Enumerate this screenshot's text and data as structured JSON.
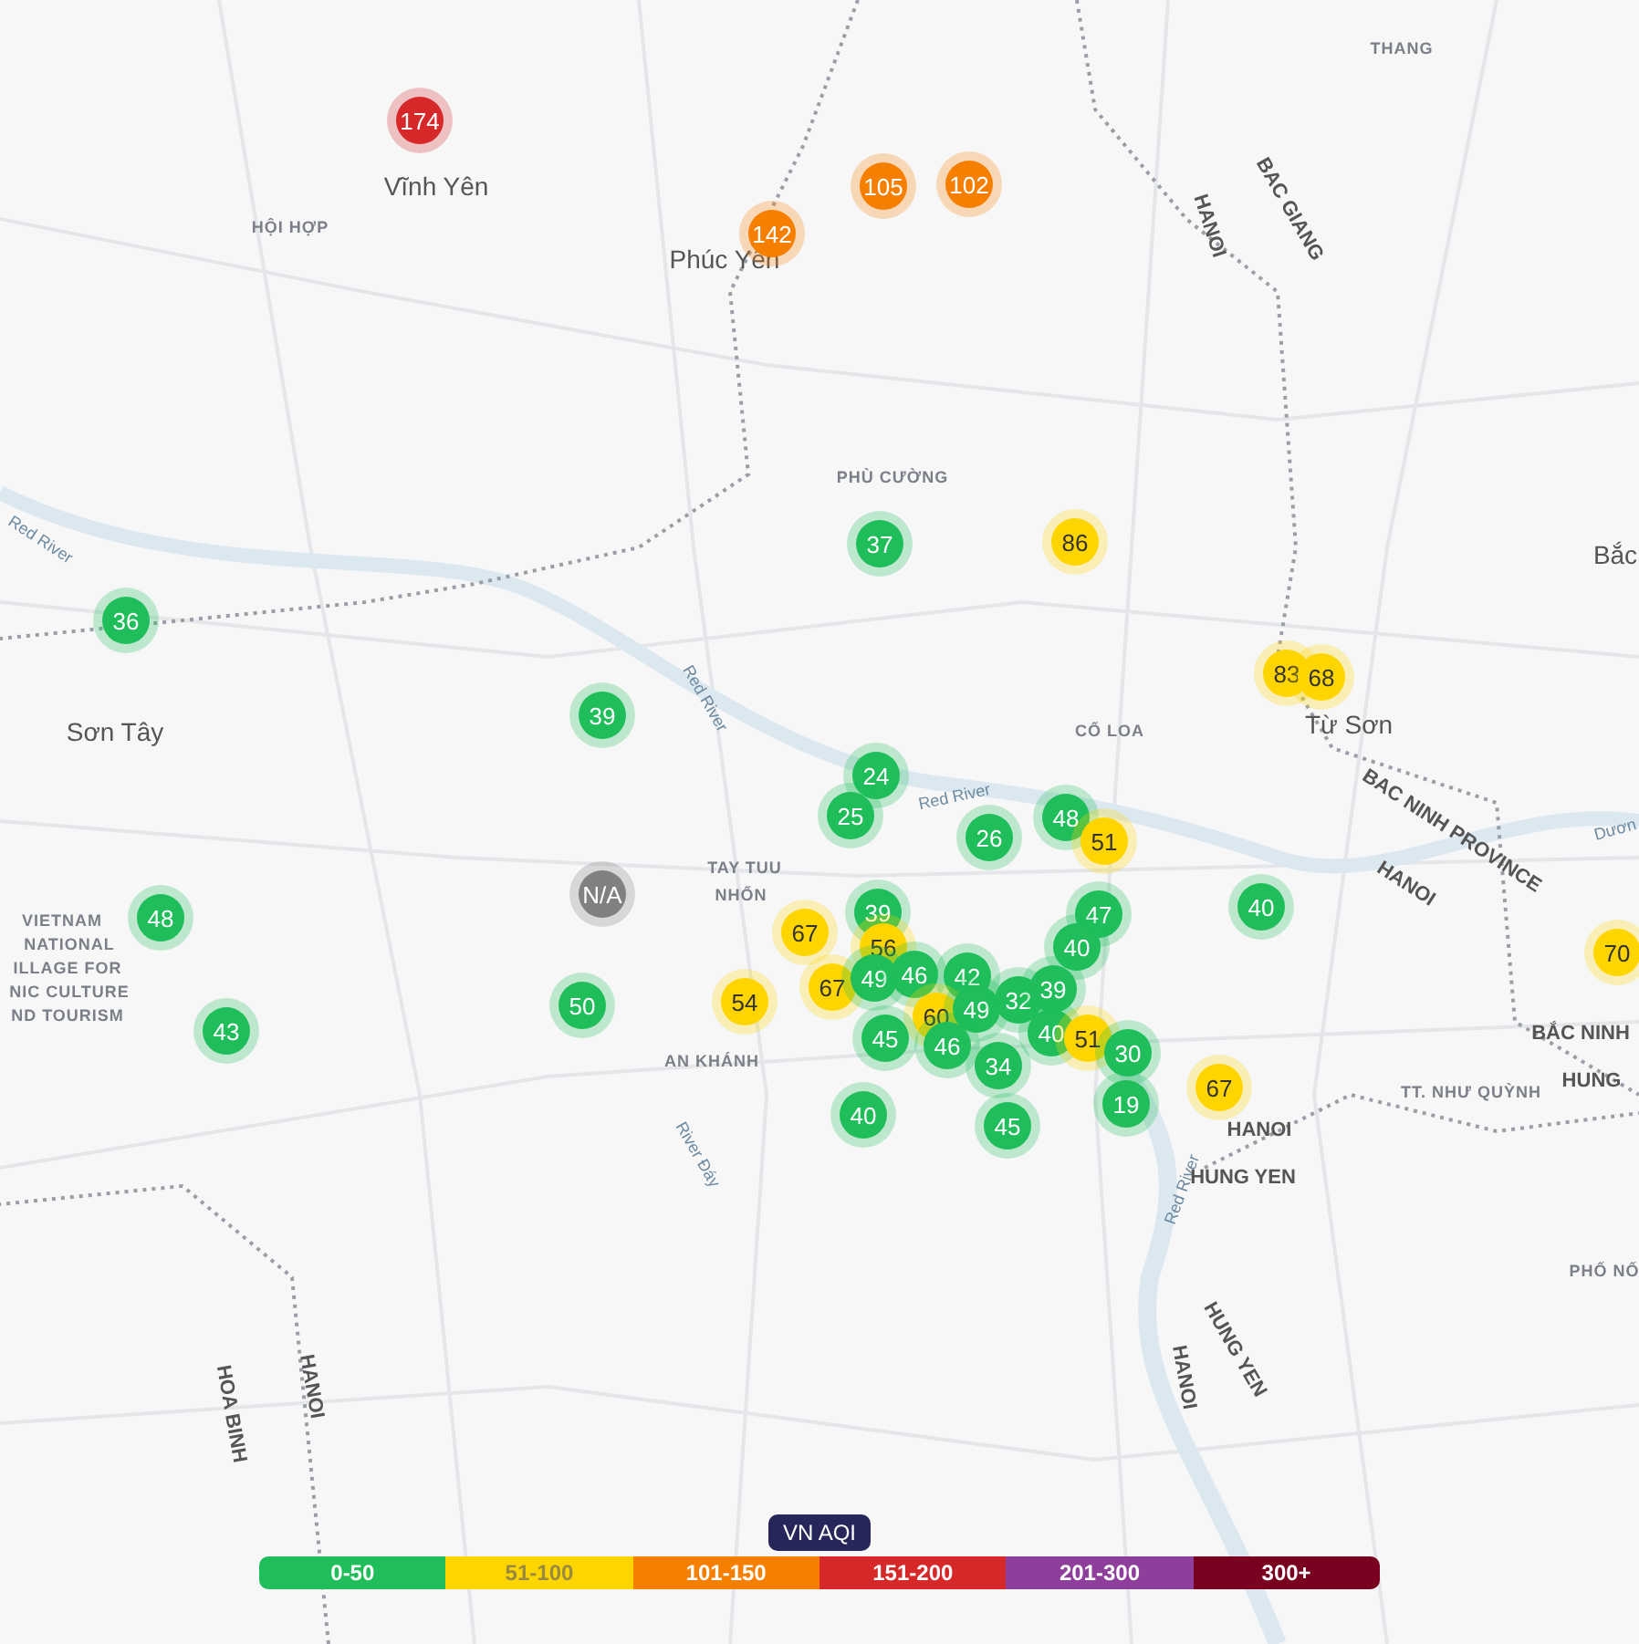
{
  "map": {
    "labels": [
      {
        "text": "Vĩnh Yên",
        "kind": "city"
      },
      {
        "text": "HỘI HỢP",
        "kind": "district"
      },
      {
        "text": "Phúc Yên",
        "kind": "city"
      },
      {
        "text": "THANG",
        "kind": "district"
      },
      {
        "text": "BAC GIANG",
        "kind": "region"
      },
      {
        "text": "HANOI",
        "kind": "region"
      },
      {
        "text": "PHÙ CƯỜNG",
        "kind": "district"
      },
      {
        "text": "Bắc",
        "kind": "city"
      },
      {
        "text": "Red River",
        "kind": "water"
      },
      {
        "text": "Sơn Tây",
        "kind": "city"
      },
      {
        "text": "Red River",
        "kind": "water"
      },
      {
        "text": "CỔ LOA",
        "kind": "district"
      },
      {
        "text": "Từ Sơn",
        "kind": "city"
      },
      {
        "text": "Red River",
        "kind": "water"
      },
      {
        "text": "BAC NINH PROVINCE",
        "kind": "region"
      },
      {
        "text": "HANOI",
        "kind": "region"
      },
      {
        "text": "Dươn",
        "kind": "water"
      },
      {
        "text": "TAY TUU",
        "kind": "district"
      },
      {
        "text": "NHỔN",
        "kind": "district"
      },
      {
        "text": "VIETNAM",
        "kind": "district"
      },
      {
        "text": "NATIONAL",
        "kind": "district"
      },
      {
        "text": "ILLAGE FOR",
        "kind": "district"
      },
      {
        "text": "NIC CULTURE",
        "kind": "district"
      },
      {
        "text": "ND TOURISM",
        "kind": "district"
      },
      {
        "text": "AN KHÁNH",
        "kind": "district"
      },
      {
        "text": "River Đáy",
        "kind": "water"
      },
      {
        "text": "BẮC NINH",
        "kind": "region"
      },
      {
        "text": "HUNG",
        "kind": "region"
      },
      {
        "text": "TT. NHƯ QUỲNH",
        "kind": "district"
      },
      {
        "text": "HANOI",
        "kind": "region"
      },
      {
        "text": "Red River",
        "kind": "water"
      },
      {
        "text": "HUNG YEN",
        "kind": "region"
      },
      {
        "text": "PHỐ NỐ",
        "kind": "district"
      },
      {
        "text": "HOA BINH",
        "kind": "region"
      },
      {
        "text": "HANOI",
        "kind": "region"
      },
      {
        "text": "HUNG YEN",
        "kind": "region"
      },
      {
        "text": "HANOI",
        "kind": "region"
      }
    ],
    "markers": [
      {
        "value": "174",
        "color": "#d62828"
      },
      {
        "value": "105",
        "color": "#f77f00"
      },
      {
        "value": "102",
        "color": "#f77f00"
      },
      {
        "value": "142",
        "color": "#f77f00"
      },
      {
        "value": "37",
        "color": "#1fbe5a"
      },
      {
        "value": "86",
        "color": "#ffd500"
      },
      {
        "value": "36",
        "color": "#1fbe5a"
      },
      {
        "value": "39",
        "color": "#1fbe5a"
      },
      {
        "value": "83",
        "color": "#ffd500"
      },
      {
        "value": "68",
        "color": "#ffd500"
      },
      {
        "value": "24",
        "color": "#1fbe5a"
      },
      {
        "value": "25",
        "color": "#1fbe5a"
      },
      {
        "value": "26",
        "color": "#1fbe5a"
      },
      {
        "value": "48",
        "color": "#1fbe5a"
      },
      {
        "value": "51",
        "color": "#ffd500"
      },
      {
        "value": "N/A",
        "color": "#808080"
      },
      {
        "value": "40",
        "color": "#1fbe5a"
      },
      {
        "value": "48",
        "color": "#1fbe5a"
      },
      {
        "value": "70",
        "color": "#ffd500"
      },
      {
        "value": "67",
        "color": "#ffd500"
      },
      {
        "value": "39",
        "color": "#1fbe5a"
      },
      {
        "value": "56",
        "color": "#ffd500"
      },
      {
        "value": "47",
        "color": "#1fbe5a"
      },
      {
        "value": "40",
        "color": "#1fbe5a"
      },
      {
        "value": "67",
        "color": "#ffd500"
      },
      {
        "value": "49",
        "color": "#1fbe5a"
      },
      {
        "value": "46",
        "color": "#1fbe5a"
      },
      {
        "value": "42",
        "color": "#1fbe5a"
      },
      {
        "value": "50",
        "color": "#1fbe5a"
      },
      {
        "value": "54",
        "color": "#ffd500"
      },
      {
        "value": "60",
        "color": "#ffd500"
      },
      {
        "value": "49",
        "color": "#1fbe5a"
      },
      {
        "value": "32",
        "color": "#1fbe5a"
      },
      {
        "value": "39",
        "color": "#1fbe5a"
      },
      {
        "value": "45",
        "color": "#1fbe5a"
      },
      {
        "value": "46",
        "color": "#1fbe5a"
      },
      {
        "value": "40",
        "color": "#1fbe5a"
      },
      {
        "value": "51",
        "color": "#ffd500"
      },
      {
        "value": "30",
        "color": "#1fbe5a"
      },
      {
        "value": "34",
        "color": "#1fbe5a"
      },
      {
        "value": "43",
        "color": "#1fbe5a"
      },
      {
        "value": "19",
        "color": "#1fbe5a"
      },
      {
        "value": "67",
        "color": "#ffd500"
      },
      {
        "value": "40",
        "color": "#1fbe5a"
      },
      {
        "value": "45",
        "color": "#1fbe5a"
      }
    ]
  },
  "legend": {
    "title": "VN AQI",
    "segments": [
      {
        "label": "0-50",
        "color": "#1fbe5a"
      },
      {
        "label": "51-100",
        "color": "#ffd500"
      },
      {
        "label": "101-150",
        "color": "#f77f00"
      },
      {
        "label": "151-200",
        "color": "#d62828"
      },
      {
        "label": "201-300",
        "color": "#8e3f9b"
      },
      {
        "label": "300+",
        "color": "#7a0020"
      }
    ]
  }
}
